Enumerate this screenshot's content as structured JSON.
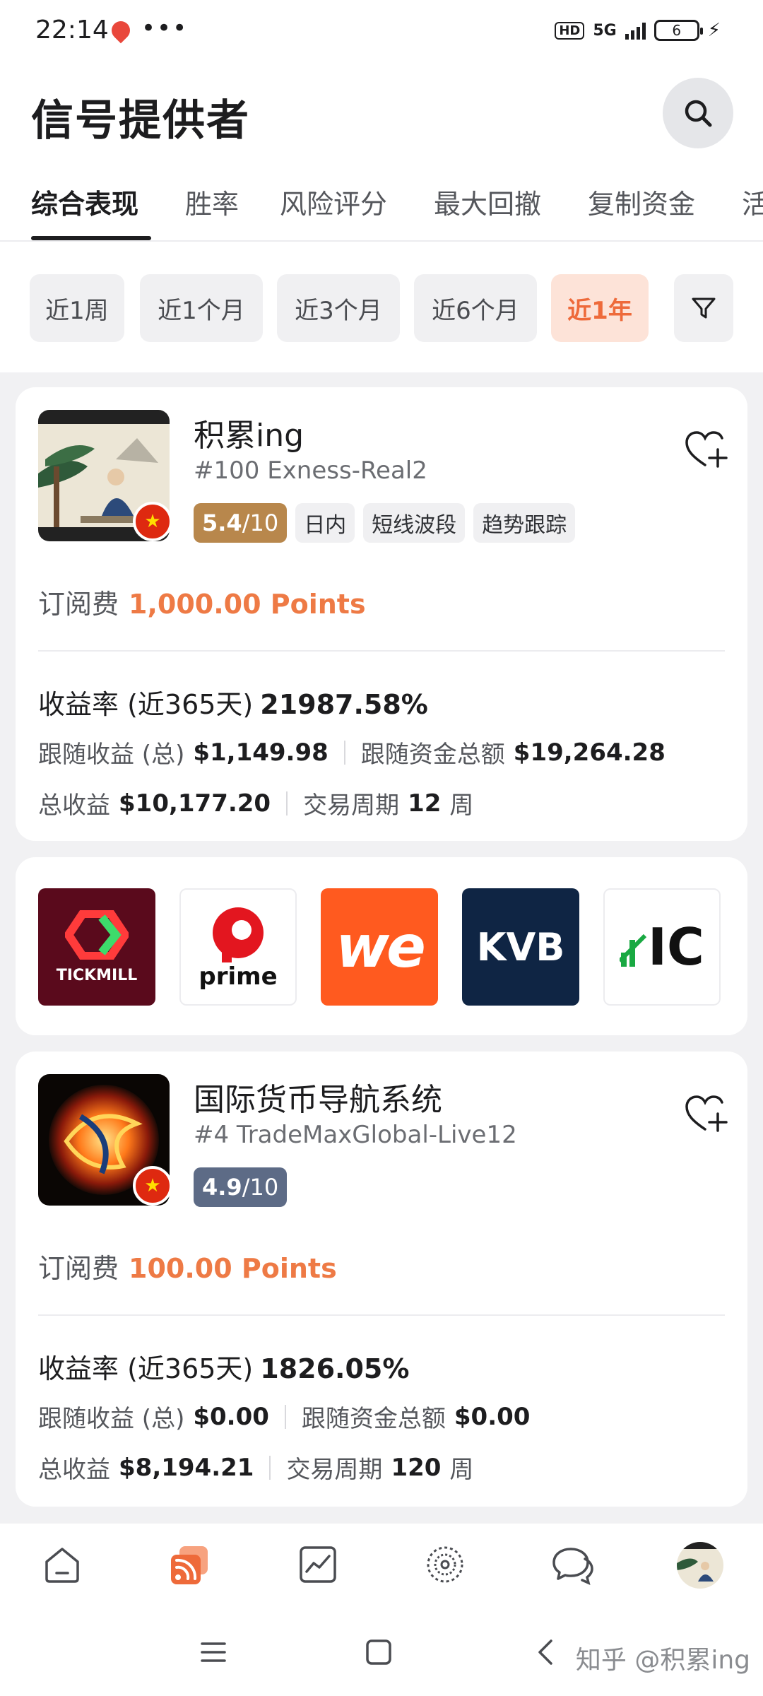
{
  "status_bar": {
    "time": "22:14",
    "dots": "•••",
    "hd": "HD",
    "network": "5G",
    "battery": "6"
  },
  "header": {
    "title": "信号提供者"
  },
  "tabs": [
    {
      "label": "综合表现",
      "active": true
    },
    {
      "label": "胜率",
      "active": false
    },
    {
      "label": "风险评分",
      "active": false
    },
    {
      "label": "最大回撤",
      "active": false
    },
    {
      "label": "复制资金",
      "active": false
    },
    {
      "label": "活",
      "active": false
    }
  ],
  "periods": [
    {
      "label": "近1周",
      "active": false
    },
    {
      "label": "近1个月",
      "active": false
    },
    {
      "label": "近3个月",
      "active": false
    },
    {
      "label": "近6个月",
      "active": false
    },
    {
      "label": "近1年",
      "active": true
    }
  ],
  "providers": [
    {
      "name": "积累ing",
      "account": "#100 Exness-Real2",
      "score": "5.4",
      "score_max": "/10",
      "score_color": "#b8874c",
      "tags": [
        "日内",
        "短线波段",
        "趋势跟踪"
      ],
      "fee_label": "订阅费",
      "fee_value": "1,000.00 Points",
      "return_label": "收益率 (近365天)",
      "return_value": "21987.58%",
      "follow_profit_label": "跟随收益 (总)",
      "follow_profit_value": "$1,149.98",
      "follow_funds_label": "跟随资金总额",
      "follow_funds_value": "$19,264.28",
      "total_profit_label": "总收益",
      "total_profit_value": "$10,177.20",
      "period_label": "交易周期",
      "period_value": "12",
      "period_unit": "周"
    },
    {
      "name": "国际货币导航系统",
      "account": "#4 TradeMaxGlobal-Live12",
      "score": "4.9",
      "score_max": "/10",
      "score_color": "#5d6b86",
      "tags": [],
      "fee_label": "订阅费",
      "fee_value": "100.00 Points",
      "return_label": "收益率 (近365天)",
      "return_value": "1826.05%",
      "follow_profit_label": "跟随收益 (总)",
      "follow_profit_value": "$0.00",
      "follow_funds_label": "跟随资金总额",
      "follow_funds_value": "$0.00",
      "total_profit_label": "总收益",
      "total_profit_value": "$8,194.21",
      "period_label": "交易周期",
      "period_value": "120",
      "period_unit": "周"
    }
  ],
  "brokers": [
    {
      "name": "TICKMILL",
      "bg": "#5a0a1c"
    },
    {
      "name": "prime",
      "bg": "#ffffff"
    },
    {
      "name": "we",
      "bg": "#ff5a1f"
    },
    {
      "name": "KVB",
      "bg": "#0f2544"
    },
    {
      "name": "IC",
      "bg": "#ffffff"
    }
  ],
  "watermark": "知乎 @积累ing"
}
